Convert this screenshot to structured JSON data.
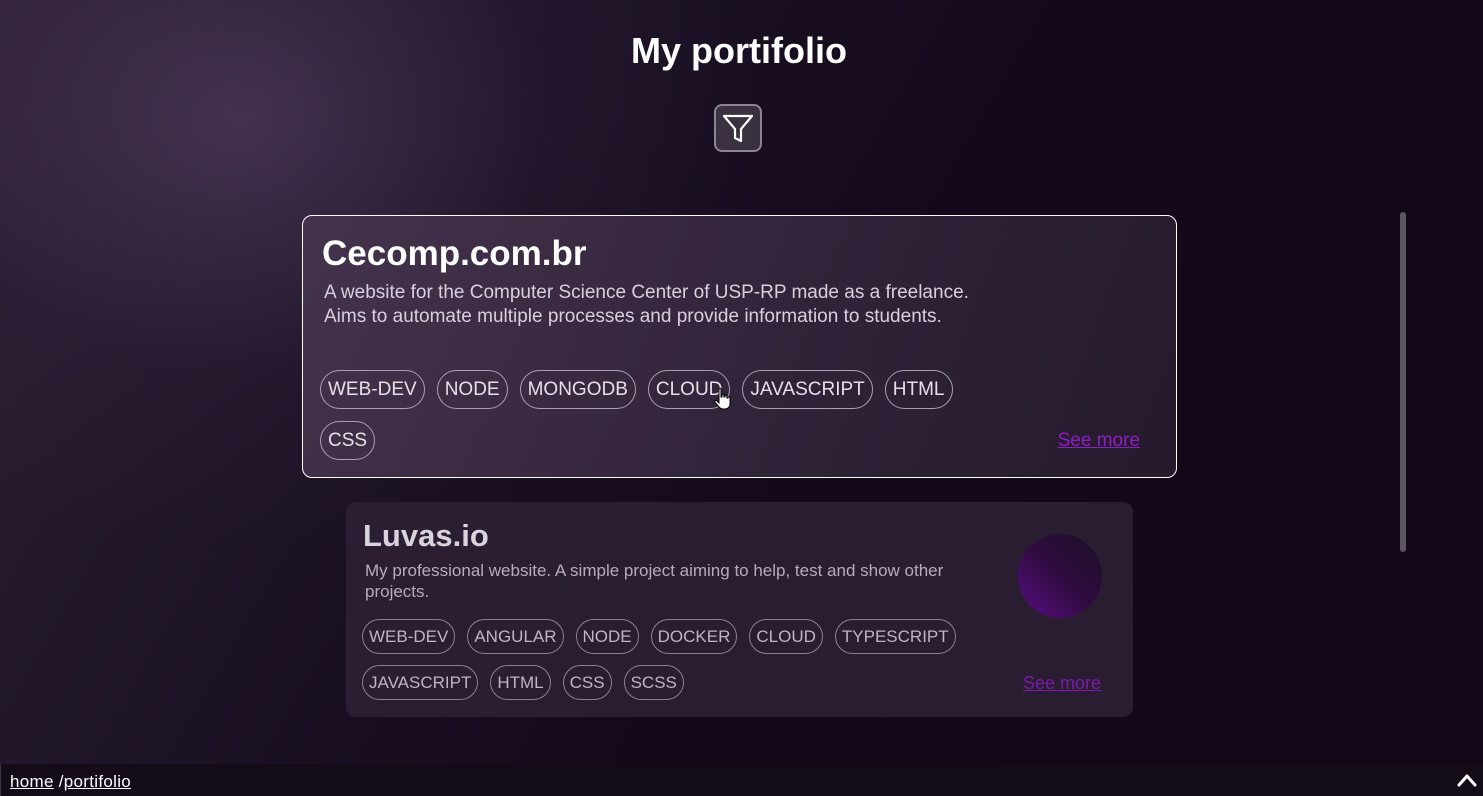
{
  "page": {
    "title": "My portifolio"
  },
  "filter_button": {
    "icon": "filter-icon"
  },
  "projects": [
    {
      "title": "Cecomp.com.br",
      "description": "A website for the Computer Science Center of USP-RP made as a freelance. Aims to automate multiple processes and provide information to students.",
      "tags": [
        "WEB-DEV",
        "NODE",
        "MONGODB",
        "CLOUD",
        "JAVASCRIPT",
        "HTML",
        "CSS"
      ],
      "see_more": "See more"
    },
    {
      "title": "Luvas.io",
      "description": "My professional website. A simple project aiming to help, test and show other projects.",
      "tags": [
        "WEB-DEV",
        "ANGULAR",
        "NODE",
        "DOCKER",
        "CLOUD",
        "TYPESCRIPT",
        "JAVASCRIPT",
        "HTML",
        "CSS",
        "SCSS"
      ],
      "see_more": "See more"
    }
  ],
  "footer": {
    "breadcrumb": {
      "home": "home",
      "separator": "/",
      "current": "portifolio"
    },
    "scroll_top_icon": "chevron-up-icon"
  },
  "colors": {
    "accent_link": "#8d1ec2",
    "background": "#14091b"
  }
}
